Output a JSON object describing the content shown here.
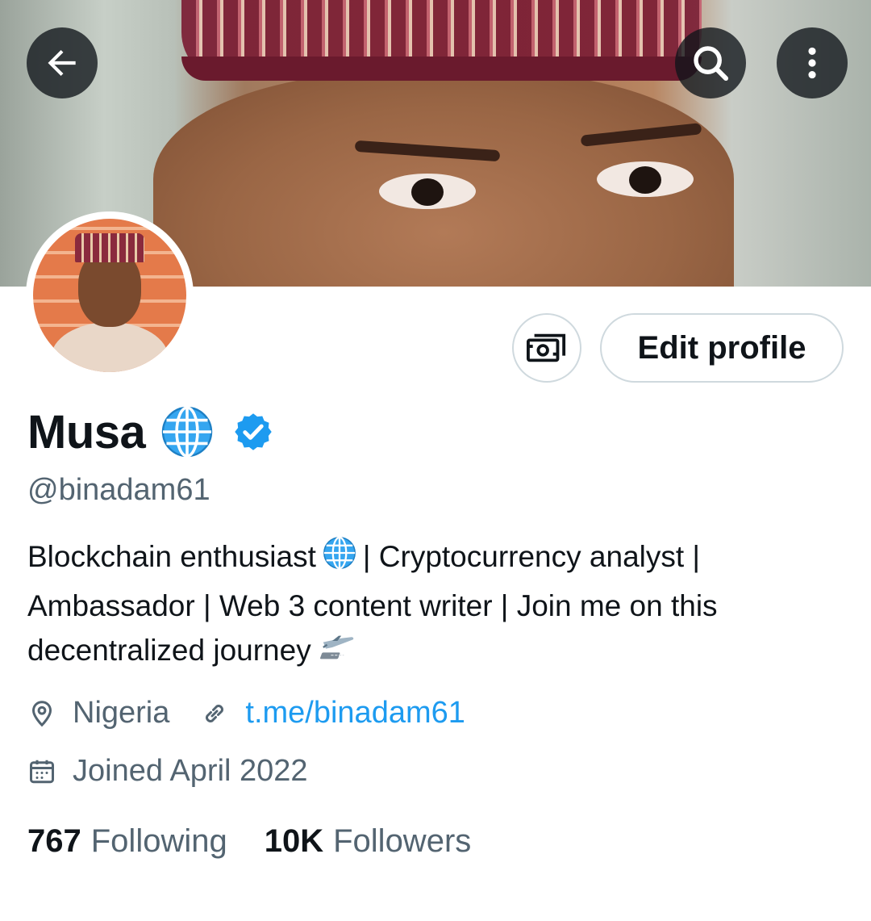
{
  "profile": {
    "display_name": "Musa",
    "name_emoji": "globe-icon",
    "verified": true,
    "handle": "@binadam61",
    "bio_line1_a": "Blockchain enthusiast",
    "bio_line1_b": "| Cryptocurrency analyst |",
    "bio_line2": "Ambassador | Web 3 content writer | Join me on this",
    "bio_line3": "decentralized journey",
    "location": "Nigeria",
    "website": "t.me/binadam61",
    "joined": "Joined April 2022"
  },
  "actions": {
    "edit_profile_label": "Edit profile"
  },
  "stats": {
    "following_count": "767",
    "following_label": "Following",
    "followers_count": "10K",
    "followers_label": "Followers"
  },
  "colors": {
    "accent": "#1d9bf0",
    "text_primary": "#0f1419",
    "text_secondary": "#536471",
    "border": "#cfd9de"
  },
  "icons": [
    "back-arrow-icon",
    "search-icon",
    "more-vertical-icon",
    "tip-jar-icon",
    "globe-icon",
    "verified-badge-icon",
    "airplane-icon",
    "location-pin-icon",
    "link-icon",
    "calendar-icon"
  ]
}
